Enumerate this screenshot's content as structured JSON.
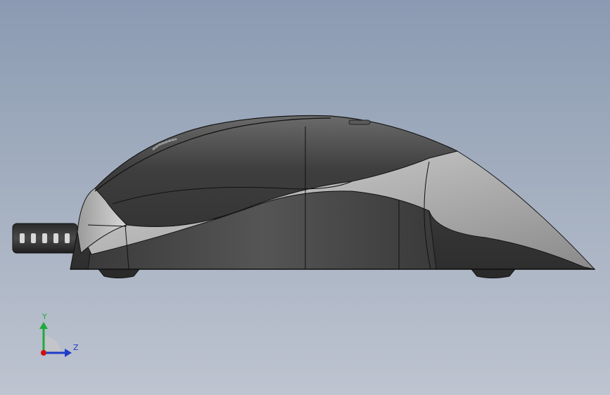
{
  "viewport": {
    "background_top": "#8b9ab2",
    "background_bottom": "#bec4d0"
  },
  "model": {
    "name": "computer-mouse",
    "view": "side view",
    "body_color": "#4a4a4a",
    "panel_color": "#b4b4b4",
    "edge_color": "#151515"
  },
  "triad": {
    "y_label": "Y",
    "z_label": "Z",
    "y_color": "#1faa3a",
    "z_color": "#1e3cc8",
    "origin_color": "#d01010"
  }
}
